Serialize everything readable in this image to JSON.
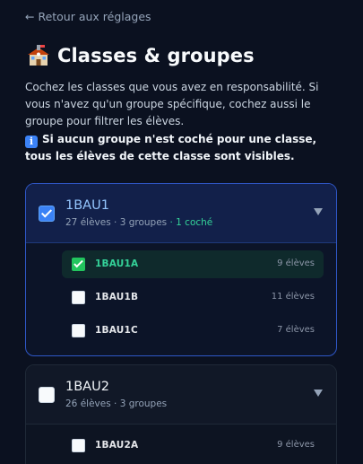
{
  "nav": {
    "back_label": "← Retour aux réglages"
  },
  "header": {
    "title": "Classes & groupes",
    "icon": "school-building-icon"
  },
  "intro": "Cochez les classes que vous avez en responsabilité. Si vous n'avez qu'un groupe spécifique, cochez aussi le groupe pour filtrer les élèves.",
  "note": "Si aucun groupe n'est coché pour une classe, tous les élèves de cette classe sont visibles.",
  "colors": {
    "accent": "#3b82f6",
    "success": "#22c55e",
    "background": "#0b1120"
  },
  "classes": [
    {
      "name": "1BAU1",
      "checked": true,
      "meta": "27 élèves · 3 groupes",
      "meta_highlight": " · 1 coché",
      "groups": [
        {
          "name": "1BAU1A",
          "count": "9 élèves",
          "checked": true
        },
        {
          "name": "1BAU1B",
          "count": "11 élèves",
          "checked": false
        },
        {
          "name": "1BAU1C",
          "count": "7 élèves",
          "checked": false
        }
      ]
    },
    {
      "name": "1BAU2",
      "checked": false,
      "meta": "26 élèves · 3 groupes",
      "meta_highlight": "",
      "groups": [
        {
          "name": "1BAU2A",
          "count": "9 élèves",
          "checked": false
        }
      ]
    }
  ]
}
